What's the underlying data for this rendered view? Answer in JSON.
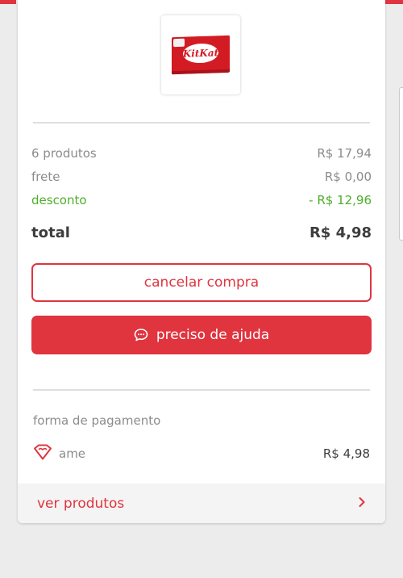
{
  "colors": {
    "accent": "#e0343f",
    "discount": "#4caf2a",
    "muted": "#8c8c8c",
    "strong": "#3d3d3d"
  },
  "product": {
    "image_brand": "KitKat",
    "image_icon": "kitkat-bar-image"
  },
  "summary": {
    "products_label": "6 produtos",
    "products_value": "R$ 17,94",
    "shipping_label": "frete",
    "shipping_value": "R$ 0,00",
    "discount_label": "desconto",
    "discount_value": "- R$ 12,96",
    "total_label": "total",
    "total_value": "R$ 4,98"
  },
  "actions": {
    "cancel_label": "cancelar compra",
    "help_label": "preciso de ajuda",
    "help_icon": "chat-bubble-icon"
  },
  "payment": {
    "section_label": "forma de pagamento",
    "method_label": "ame",
    "method_icon": "ame-heart-icon",
    "amount": "R$ 4,98"
  },
  "footer": {
    "label": "ver produtos",
    "icon": "chevron-right-icon"
  }
}
